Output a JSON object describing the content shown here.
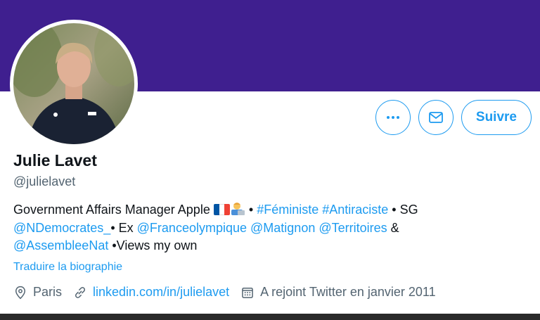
{
  "profile": {
    "name": "Julie Lavet",
    "handle": "@julielavet",
    "follow_label": "Suivre"
  },
  "bio": {
    "line1_text": "Government Affairs Manager Apple",
    "line1_sep": "•",
    "hashtag1": "#Féministe",
    "hashtag2": "#Antiraciste",
    "line1_tail": "• SG",
    "mention1": "@NDemocrates_",
    "line2_mid": "• Ex",
    "mention2": "@Franceolympique",
    "mention3": "@Matignon",
    "mention4": "@Territoires",
    "amp": "&",
    "mention5": "@AssembleeNat",
    "line3_tail": "•Views my own"
  },
  "translate_label": "Traduire la biographie",
  "meta": {
    "location": "Paris",
    "website": "linkedin.com/in/julielavet",
    "joined": "A rejoint Twitter en janvier 2011"
  },
  "icons": {
    "more": "more-horizontal-icon",
    "message": "envelope-icon",
    "location": "location-pin-icon",
    "link": "link-icon",
    "calendar": "calendar-icon",
    "flag": "flag-france-icon",
    "person": "technologist-emoji-icon"
  },
  "colors": {
    "banner": "#3f1f8f",
    "accent": "#1d9bf0",
    "secondary_text": "#536471"
  }
}
